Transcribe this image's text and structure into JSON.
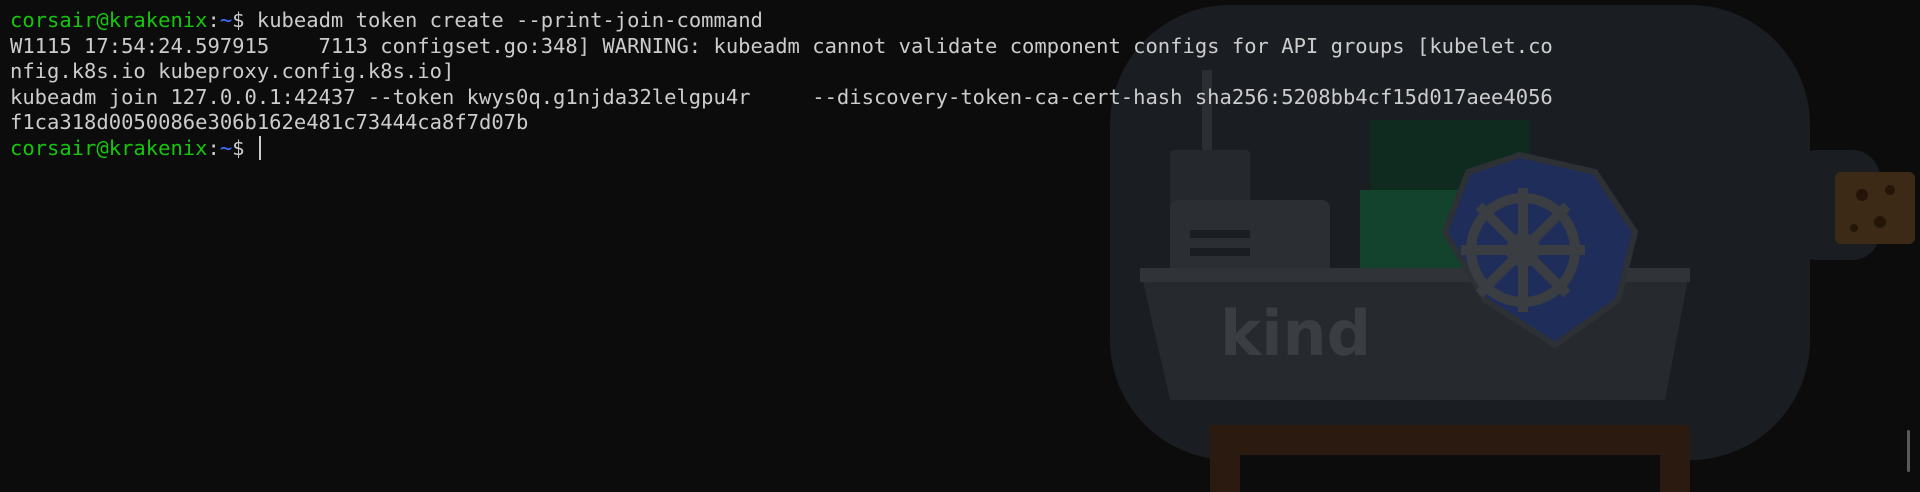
{
  "prompt": {
    "user_host": "corsair@krakenix",
    "colon": ":",
    "path": "~",
    "dollar": "$ "
  },
  "lines": {
    "command": "kubeadm token create --print-join-command",
    "warning_1": "W1115 17:54:24.597915    7113 configset.go:348] WARNING: kubeadm cannot validate component configs for API groups [kubelet.co",
    "warning_2": "nfig.k8s.io kubeproxy.config.k8s.io]",
    "join_1": "kubeadm join 127.0.0.1:42437 --token kwys0q.g1njda32lelgpu4r     --discovery-token-ca-cert-hash sha256:5208bb4cf15d017aee4056",
    "join_2": "f1ca318d0050086e306b162e481c73444ca8f7d07b"
  },
  "background": {
    "logo_text": "kind",
    "icon": "kubernetes-helm-wheel-icon"
  },
  "colors": {
    "background": "#0c0c0c",
    "foreground": "#cccccc",
    "prompt_user": "#16c60c",
    "prompt_path": "#3b78ff"
  }
}
